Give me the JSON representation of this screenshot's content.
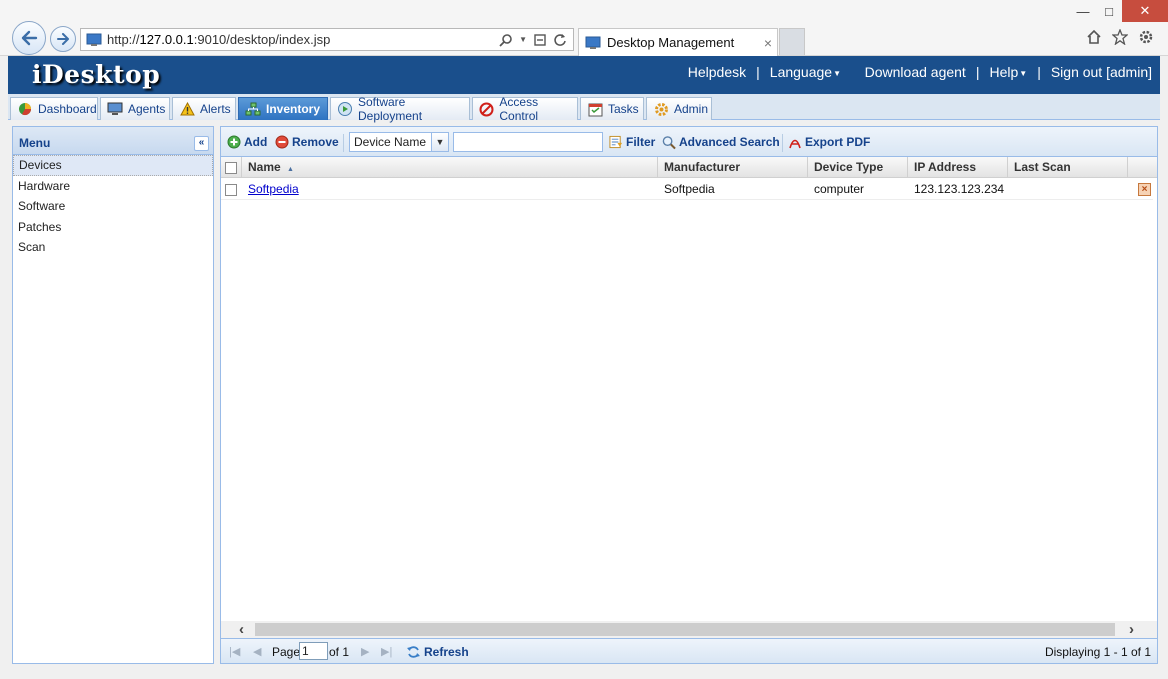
{
  "browser": {
    "url_prefix": "http://",
    "url_host": "127.0.0.1",
    "url_rest": ":9010/desktop/index.jsp",
    "tab_title": "Desktop Management",
    "tab_close": "×",
    "minimize": "—",
    "maximize": "□",
    "close": "✕"
  },
  "header": {
    "logo": "iDesktop",
    "links": [
      "Helpdesk",
      "Language",
      "Download agent",
      "Help",
      "Sign out [admin]"
    ],
    "separator": "|"
  },
  "tabs": [
    {
      "label": "Dashboard",
      "icon": "pie-chart-icon"
    },
    {
      "label": "Agents",
      "icon": "monitor-icon"
    },
    {
      "label": "Alerts",
      "icon": "warning-icon"
    },
    {
      "label": "Inventory",
      "icon": "network-icon",
      "active": true
    },
    {
      "label": "Software Deployment",
      "icon": "deploy-icon"
    },
    {
      "label": "Access Control",
      "icon": "no-entry-icon"
    },
    {
      "label": "Tasks",
      "icon": "calendar-icon"
    },
    {
      "label": "Admin",
      "icon": "gear-icon"
    }
  ],
  "menu": {
    "title": "Menu",
    "collapse": "«",
    "items": [
      "Devices",
      "Hardware",
      "Software",
      "Patches",
      "Scan"
    ],
    "selected": "Devices"
  },
  "toolbar": {
    "add": "Add",
    "remove": "Remove",
    "field": "Device Name",
    "search_value": "",
    "filter": "Filter",
    "advanced_search": "Advanced Search",
    "export_pdf": "Export PDF"
  },
  "grid": {
    "columns": [
      "Name",
      "Manufacturer",
      "Device Type",
      "IP Address",
      "Last Scan"
    ],
    "sort_indicator": "▲",
    "rows": [
      {
        "name": "Softpedia",
        "manufacturer": "Softpedia",
        "device_type": "computer",
        "ip": "123.123.123.234",
        "last_scan": ""
      }
    ]
  },
  "paging": {
    "page_label": "Page",
    "page": "1",
    "of_label": "of 1",
    "refresh": "Refresh",
    "displaying": "Displaying 1 - 1 of 1"
  },
  "colors": {
    "header_bg": "#1a4f8c",
    "active_tab": "#2e73c2",
    "link": "#0000cc",
    "panel_border": "#99bbe8"
  }
}
